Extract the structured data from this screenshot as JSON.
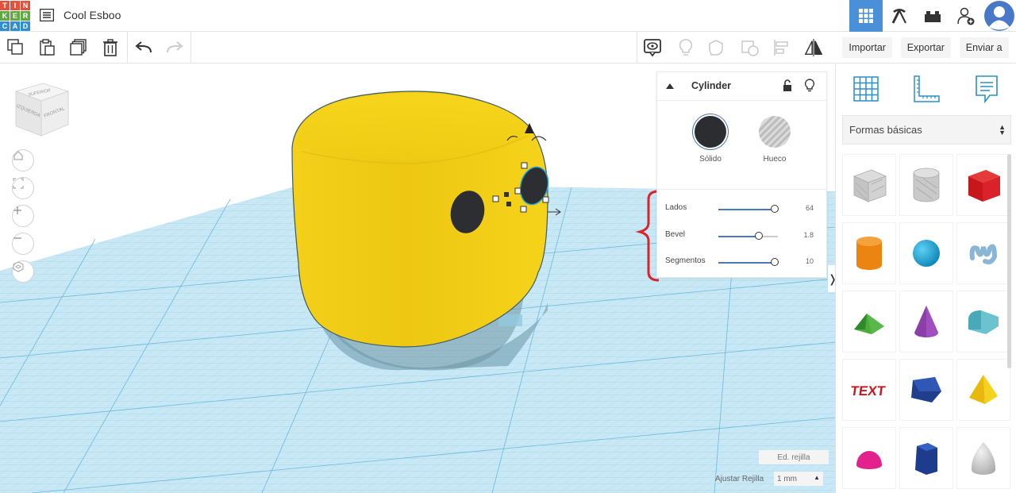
{
  "app": {
    "logo_letters": [
      "T",
      "I",
      "N",
      "K",
      "E",
      "R",
      "C",
      "A",
      "D"
    ],
    "logo_colors": [
      "#e2533d",
      "#e2533d",
      "#e2533d",
      "#62a744",
      "#62a744",
      "#62a744",
      "#2f8fd6",
      "#2f8fd6",
      "#2f8fd6"
    ],
    "document_title": "Cool Esboo"
  },
  "top_icons": [
    "grid-view-icon",
    "pickaxe-icon",
    "bricks-icon",
    "add-user-icon",
    "profile-avatar-icon"
  ],
  "toolbar": {
    "tools": [
      "copy-icon",
      "paste-icon",
      "duplicate-icon",
      "delete-icon",
      "undo-icon",
      "redo-icon"
    ],
    "view_tools": [
      "notes-icon",
      "light-icon",
      "group-icon",
      "hole-icon",
      "align-icon",
      "mirror-icon"
    ]
  },
  "actions": {
    "import": "Importar",
    "export": "Exportar",
    "send": "Enviar a"
  },
  "viewcube": {
    "top": "SUPERIOR",
    "left": "IZQUIERDA",
    "front": "FRONTAL"
  },
  "shape_panel": {
    "title": "Cylinder",
    "solid_label": "Sólido",
    "hole_label": "Hueco",
    "sliders": [
      {
        "label": "Lados",
        "value": "64",
        "fraction": 0.95
      },
      {
        "label": "Bevel",
        "value": "1.8",
        "fraction": 0.68
      },
      {
        "label": "Segmentos",
        "value": "10",
        "fraction": 0.95
      }
    ]
  },
  "grid": {
    "edit_label": "Ed. rejilla",
    "snap_label": "Ajustar Rejilla",
    "snap_value": "1 mm"
  },
  "library": {
    "category": "Formas básicas",
    "shapes": [
      "box-hole-shape",
      "cylinder-hole-shape",
      "box-shape",
      "cylinder-shape",
      "sphere-shape",
      "scribble-shape",
      "roof-shape",
      "cone-shape",
      "round-roof-shape",
      "text-shape",
      "polygon-shape",
      "pyramid-shape",
      "half-sphere-shape",
      "prism-shape",
      "paraboloid-shape"
    ]
  },
  "colors": {
    "accent": "#4a90d9",
    "cube_yellow": "#f2cd12",
    "annotation_red": "#d9252a",
    "grid_blue": "#bfe3f2"
  }
}
